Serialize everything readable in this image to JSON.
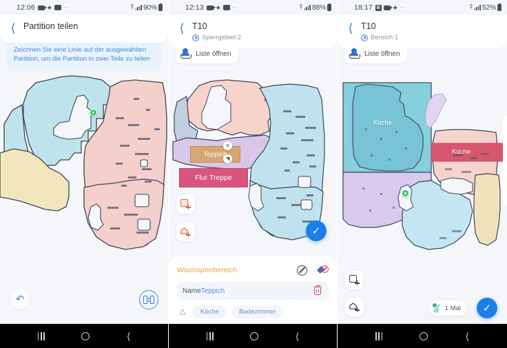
{
  "accent": {
    "blue": "#1a7fea",
    "link": "#4a8ad4",
    "orange": "#e8a33c",
    "red": "#d9425c",
    "green": "#2ec96a"
  },
  "panels": [
    {
      "statusbar": {
        "time": "12:06",
        "battery_pct": "90%",
        "left_icons": [
          "video-icon",
          "bluetooth-icon",
          "message-icon",
          "more-dots-icon"
        ],
        "right_icons": [
          "wifi-icon",
          "signal-icon",
          "battery-icon"
        ]
      },
      "header": {
        "title": "Partition teilen",
        "back_label": "back-chevron"
      },
      "banner": "Zeichnen Sie eine Linie auf der ausgewählten Partition, um die Partition in zwei Teile zu teilen",
      "controls": {
        "undo_label": "undo-icon",
        "split_label": "split-partition-icon"
      },
      "map": {
        "regions": [
          {
            "name": "region-blue",
            "color": "#bfe3ea"
          },
          {
            "name": "region-pink",
            "color": "#f4cfcc"
          },
          {
            "name": "region-yellow",
            "color": "#f2e6bc"
          }
        ],
        "dock_marker": "dock-icon"
      },
      "navbar": {
        "recents": "recents-icon",
        "home": "home-icon",
        "back": "back-icon"
      }
    },
    {
      "statusbar": {
        "time": "12:13",
        "battery_pct": "88%",
        "left_icons": [
          "video-icon",
          "bluetooth-icon",
          "message-icon",
          "more-dots-icon"
        ],
        "right_icons": [
          "wifi-icon",
          "signal-icon",
          "battery-icon"
        ]
      },
      "header": {
        "title": "T10",
        "subtitle": "Sperrgebiet:2",
        "back_label": "back-chevron"
      },
      "list_button": {
        "label": "Liste öffnen",
        "icon": "open-list-icon"
      },
      "map": {
        "regions": [
          {
            "name": "region-pink",
            "color": "#f6d3cb"
          },
          {
            "name": "region-blue",
            "color": "#bfe2ee"
          },
          {
            "name": "region-purple",
            "color": "#d9c7ea"
          },
          {
            "name": "region-steel",
            "color": "#c3cfe0"
          }
        ],
        "zones": [
          {
            "name": "Teppich",
            "color": "#d8a673",
            "type": "carpet-zone"
          },
          {
            "name": "Flur Treppe",
            "color": "#d9557f",
            "type": "no-go-zone"
          }
        ],
        "robot_marker": "robot-position-icon"
      },
      "controls": {
        "add_rect_label": "add-rectangle-zone-icon",
        "add_poly_label": "add-polygon-zone-icon",
        "confirm_label": "confirm-check-icon"
      },
      "sheet": {
        "title": "Wischsperrbereich",
        "icons": [
          "no-entry-icon",
          "no-mop-icon"
        ],
        "name_label": "Name",
        "name_value": "Teppich",
        "delete_label": "delete-trash-icon",
        "collapse_label": "chevron-up-icon",
        "chips": [
          "Küche",
          "Badezimmer"
        ]
      },
      "navbar": {
        "recents": "recents-icon",
        "home": "home-icon",
        "back": "back-icon"
      }
    },
    {
      "statusbar": {
        "time": "18:17",
        "battery_pct": "52%",
        "left_icons": [
          "b-badge-icon",
          "video-icon",
          "bluetooth-icon",
          "more-dots-icon"
        ],
        "right_icons": [
          "wifi-icon",
          "signal-icon",
          "battery-icon"
        ]
      },
      "header": {
        "title": "T10",
        "subtitle": "Bereich:1",
        "back_label": "back-chevron"
      },
      "list_button": {
        "label": "Liste öffnen",
        "icon": "open-list-icon"
      },
      "map": {
        "regions": [
          {
            "name": "region-teal",
            "color": "#86cfdd"
          },
          {
            "name": "region-purple",
            "color": "#d8c9ee"
          },
          {
            "name": "region-lightblue",
            "color": "#c4e6f2"
          },
          {
            "name": "region-pink",
            "color": "#f6d3cd"
          },
          {
            "name": "region-yellow",
            "color": "#f0e3bb"
          },
          {
            "name": "region-lavender",
            "color": "#e3d4f2"
          }
        ],
        "labels": [
          {
            "text": "Küche",
            "kind": "room-label-teal"
          },
          {
            "text": "Küche",
            "kind": "room-label-band"
          }
        ],
        "band_color": "#d9566f",
        "dock_marker": "dock-icon"
      },
      "controls": {
        "add_rect_label": "add-rectangle-zone-icon",
        "add_poly_label": "add-polygon-zone-icon",
        "times_badge": "1 Mal",
        "times_icon": "clean-count-icon",
        "confirm_label": "confirm-check-icon"
      },
      "navbar": {
        "recents": "recents-icon",
        "home": "home-icon",
        "back": "back-icon"
      }
    }
  ]
}
